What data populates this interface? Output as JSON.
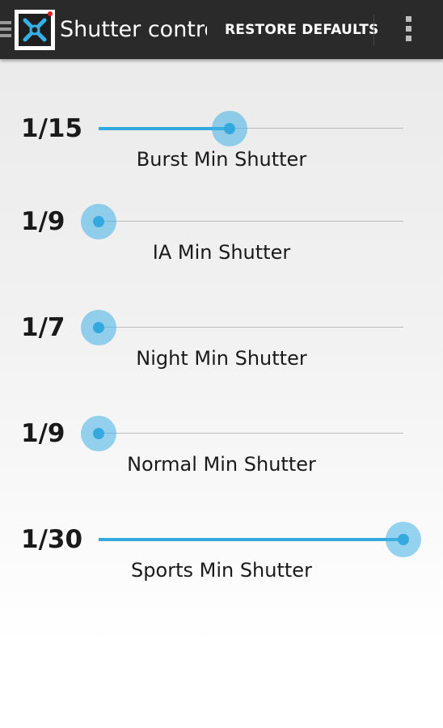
{
  "action_bar": {
    "title": "Shutter control",
    "restore_label": "RESTORE DEFAULTS",
    "drawer_icon": "hamburger-icon",
    "app_icon": "wrench-screwdriver-icon",
    "overflow_icon": "overflow-menu-icon"
  },
  "accent_color": "#33a9df",
  "settings": [
    {
      "value_label": "1/15",
      "name": "Burst Min Shutter",
      "slider_fraction": 0.43
    },
    {
      "value_label": "1/9",
      "name": "IA Min Shutter",
      "slider_fraction": 0.0
    },
    {
      "value_label": "1/7",
      "name": "Night Min Shutter",
      "slider_fraction": 0.0
    },
    {
      "value_label": "1/9",
      "name": "Normal Min Shutter",
      "slider_fraction": 0.0
    },
    {
      "value_label": "1/30",
      "name": "Sports Min Shutter",
      "slider_fraction": 1.0
    }
  ]
}
